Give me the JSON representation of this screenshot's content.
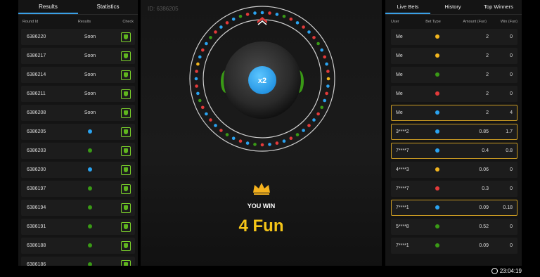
{
  "colors": {
    "blue": "#2aa3f0",
    "green": "#3a9a16",
    "yellow": "#f2b51e",
    "red": "#e33a3a",
    "gold": "#f5c518",
    "accent": "#3aa0e6"
  },
  "left": {
    "tabs": [
      "Results",
      "Statistics"
    ],
    "headers": {
      "round": "Round Id",
      "results": "Results",
      "check": "Check"
    },
    "rows": [
      {
        "round": "6386220",
        "result": "Soon",
        "dot": ""
      },
      {
        "round": "6386217",
        "result": "Soon",
        "dot": ""
      },
      {
        "round": "6386214",
        "result": "Soon",
        "dot": ""
      },
      {
        "round": "6386211",
        "result": "Soon",
        "dot": ""
      },
      {
        "round": "6386208",
        "result": "Soon",
        "dot": ""
      },
      {
        "round": "6386205",
        "result": "",
        "dot": "blue"
      },
      {
        "round": "6386203",
        "result": "",
        "dot": "green"
      },
      {
        "round": "6386200",
        "result": "",
        "dot": "blue"
      },
      {
        "round": "6386197",
        "result": "",
        "dot": "green"
      },
      {
        "round": "6386194",
        "result": "",
        "dot": "green"
      },
      {
        "round": "6386191",
        "result": "",
        "dot": "green"
      },
      {
        "round": "6386188",
        "result": "",
        "dot": "green"
      },
      {
        "round": "6386186",
        "result": "",
        "dot": "green"
      }
    ]
  },
  "middle": {
    "round_label": "ID: 6386205",
    "multiplier": "x2",
    "you_win": "YOU WIN",
    "amount": "4 Fun"
  },
  "right": {
    "tabs": [
      "Live Bets",
      "History",
      "Top Winners"
    ],
    "headers": {
      "user": "User",
      "bet": "Bet Type",
      "amount": "Amount (Fun)",
      "win": "Win (Fun)"
    },
    "rows": [
      {
        "user": "Me",
        "dot": "yellow",
        "amount": "2",
        "win": "0",
        "highlight": false
      },
      {
        "user": "Me",
        "dot": "yellow",
        "amount": "2",
        "win": "0",
        "highlight": false
      },
      {
        "user": "Me",
        "dot": "green",
        "amount": "2",
        "win": "0",
        "highlight": false
      },
      {
        "user": "Me",
        "dot": "red",
        "amount": "2",
        "win": "0",
        "highlight": false
      },
      {
        "user": "Me",
        "dot": "blue",
        "amount": "2",
        "win": "4",
        "highlight": true
      },
      {
        "user": "3****2",
        "dot": "blue",
        "amount": "0.85",
        "win": "1.7",
        "highlight": true
      },
      {
        "user": "7****7",
        "dot": "blue",
        "amount": "0.4",
        "win": "0.8",
        "highlight": true
      },
      {
        "user": "4****3",
        "dot": "yellow",
        "amount": "0.06",
        "win": "0",
        "highlight": false
      },
      {
        "user": "7****7",
        "dot": "red",
        "amount": "0.3",
        "win": "0",
        "highlight": false
      },
      {
        "user": "7****1",
        "dot": "blue",
        "amount": "0.09",
        "win": "0.18",
        "highlight": true
      },
      {
        "user": "5****8",
        "dot": "green",
        "amount": "0.52",
        "win": "0",
        "highlight": false
      },
      {
        "user": "7****1",
        "dot": "green",
        "amount": "0.09",
        "win": "0",
        "highlight": false
      }
    ]
  },
  "clock": "23:04:19"
}
